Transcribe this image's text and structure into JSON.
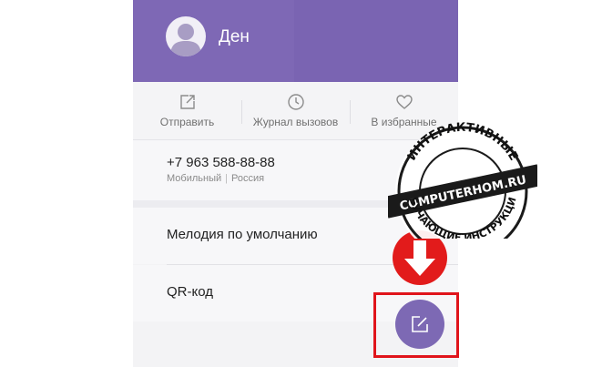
{
  "contact": {
    "name": "Ден"
  },
  "actions": [
    {
      "label": "Отправить",
      "icon": "share-icon"
    },
    {
      "label": "Журнал вызовов",
      "icon": "clock-icon"
    },
    {
      "label": "В избранные",
      "icon": "heart-icon"
    }
  ],
  "phone": {
    "number": "+7 963 588-88-88",
    "type": "Мобильный",
    "separator": "|",
    "country": "Россия"
  },
  "menu": {
    "ringtone": "Мелодия по умолчанию",
    "qr": "QR-код"
  },
  "watermark": {
    "top_text": "ИНТЕРАКТИВНЫЕ",
    "site": "COMPUTERHOM.RU",
    "bottom_text": "ОБУЧАЮЩИЕ ИНСТРУКЦИИ"
  },
  "colors": {
    "header": "#7e68b5",
    "fab": "#7d69b4",
    "highlight": "#e0141b",
    "arrow": "#e21b1b"
  }
}
